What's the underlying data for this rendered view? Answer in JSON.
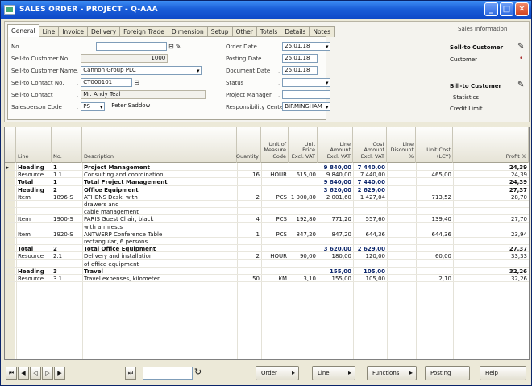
{
  "window": {
    "title": "SALES ORDER - PROJECT - Q-AAA"
  },
  "tabs": [
    "General",
    "Line",
    "Invoice",
    "Delivery",
    "Foreign Trade",
    "Dimension",
    "Setup",
    "Other",
    "Totals",
    "Details",
    "Notes"
  ],
  "form_left": [
    {
      "label": "No.",
      "value": "",
      "kind": "input-pick"
    },
    {
      "label": "Sell-to Customer No.",
      "value": "1000",
      "kind": "ro"
    },
    {
      "label": "Sell-to Customer Name",
      "value": "Cannon Group PLC",
      "kind": "dropdown"
    },
    {
      "label": "Sell-to Contact No.",
      "value": "CT000101",
      "kind": "input-pick"
    },
    {
      "label": "Sell-to Contact",
      "value": "Mr. Andy Teal",
      "kind": "ro"
    },
    {
      "label": "Salesperson Code",
      "value": "PS",
      "kind": "dropdown",
      "extra": "Peter Saddow"
    }
  ],
  "form_right": [
    {
      "label": "Order Date",
      "value": "25.01.18",
      "kind": "dropdown"
    },
    {
      "label": "Posting Date",
      "value": "25.01.18",
      "kind": "input"
    },
    {
      "label": "Document Date",
      "value": "25.01.18",
      "kind": "input"
    },
    {
      "label": "Status",
      "value": "",
      "kind": "dropdown"
    },
    {
      "label": "Project Manager",
      "value": "",
      "kind": "input"
    },
    {
      "label": "Responsibility Center",
      "value": "BIRMINGHAM",
      "kind": "dropdown"
    }
  ],
  "side_panel": {
    "title": "Sales Information",
    "items": [
      {
        "label": "Sell-to Customer",
        "bold": true
      },
      {
        "label": "Customer",
        "bold": false
      },
      {
        "label": "Bill-to Customer",
        "bold": true
      },
      {
        "label": "Statistics",
        "bold": false
      },
      {
        "label": "Credit Limit",
        "bold": false
      }
    ]
  },
  "grid": {
    "columns": [
      "",
      "Line",
      "No.",
      "Description",
      "Quantity",
      "Unit of Measure Code",
      "Unit Price Excl. VAT",
      "Line Amount Excl. VAT",
      "Cost Amount Excl. VAT",
      "Line Discount %",
      "Unit Cost (LCY)",
      "Profit %"
    ],
    "rows": [
      {
        "mark": "▸",
        "type": "Heading",
        "no": "1",
        "desc": "Project Management",
        "qty": "",
        "uom": "",
        "price": "",
        "amt": "9 840,00",
        "cost": "7 440,00",
        "disc": "",
        "ucost": "",
        "profit": "24,39",
        "bold": true
      },
      {
        "mark": "",
        "type": "Resource",
        "no": "1.1",
        "desc": "Consulting and coordination",
        "qty": "16",
        "uom": "HOUR",
        "price": "615,00",
        "amt": "9 840,00",
        "cost": "7 440,00",
        "disc": "",
        "ucost": "465,00",
        "profit": "24,39",
        "bold": false
      },
      {
        "mark": "",
        "type": "Total",
        "no": "1",
        "desc": "Total Project Management",
        "qty": "",
        "uom": "",
        "price": "",
        "amt": "9 840,00",
        "cost": "7 440,00",
        "disc": "",
        "ucost": "",
        "profit": "24,39",
        "bold": true
      },
      {
        "mark": "",
        "type": "Heading",
        "no": "2",
        "desc": "Office Equipment",
        "qty": "",
        "uom": "",
        "price": "",
        "amt": "3 620,00",
        "cost": "2 629,00",
        "disc": "",
        "ucost": "",
        "profit": "27,37",
        "bold": true
      },
      {
        "mark": "",
        "type": "Item",
        "no": "1896-S",
        "desc": "ATHENS Desk, with",
        "qty": "2",
        "uom": "PCS",
        "price": "1 000,80",
        "amt": "2 001,60",
        "cost": "1 427,04",
        "disc": "",
        "ucost": "713,52",
        "profit": "28,70",
        "bold": false
      },
      {
        "mark": "",
        "type": "",
        "no": "",
        "desc": "drawers and",
        "qty": "",
        "uom": "",
        "price": "",
        "amt": "",
        "cost": "",
        "disc": "",
        "ucost": "",
        "profit": "",
        "bold": false
      },
      {
        "mark": "",
        "type": "",
        "no": "",
        "desc": "cable management",
        "qty": "",
        "uom": "",
        "price": "",
        "amt": "",
        "cost": "",
        "disc": "",
        "ucost": "",
        "profit": "",
        "bold": false
      },
      {
        "mark": "",
        "type": "Item",
        "no": "1900-S",
        "desc": "PARIS Guest Chair, black",
        "qty": "4",
        "uom": "PCS",
        "price": "192,80",
        "amt": "771,20",
        "cost": "557,60",
        "disc": "",
        "ucost": "139,40",
        "profit": "27,70",
        "bold": false
      },
      {
        "mark": "",
        "type": "",
        "no": "",
        "desc": "with armrests",
        "qty": "",
        "uom": "",
        "price": "",
        "amt": "",
        "cost": "",
        "disc": "",
        "ucost": "",
        "profit": "",
        "bold": false
      },
      {
        "mark": "",
        "type": "Item",
        "no": "1920-S",
        "desc": "ANTWERP Conference Table",
        "qty": "1",
        "uom": "PCS",
        "price": "847,20",
        "amt": "847,20",
        "cost": "644,36",
        "disc": "",
        "ucost": "644,36",
        "profit": "23,94",
        "bold": false
      },
      {
        "mark": "",
        "type": "",
        "no": "",
        "desc": "rectangular, 6 persons",
        "qty": "",
        "uom": "",
        "price": "",
        "amt": "",
        "cost": "",
        "disc": "",
        "ucost": "",
        "profit": "",
        "bold": false
      },
      {
        "mark": "",
        "type": "Total",
        "no": "2",
        "desc": "Total Office Equipment",
        "qty": "",
        "uom": "",
        "price": "",
        "amt": "3 620,00",
        "cost": "2 629,00",
        "disc": "",
        "ucost": "",
        "profit": "27,37",
        "bold": true
      },
      {
        "mark": "",
        "type": "Resource",
        "no": "2.1",
        "desc": "Delivery and installation",
        "qty": "2",
        "uom": "HOUR",
        "price": "90,00",
        "amt": "180,00",
        "cost": "120,00",
        "disc": "",
        "ucost": "60,00",
        "profit": "33,33",
        "bold": false
      },
      {
        "mark": "",
        "type": "",
        "no": "",
        "desc": "of office equipment",
        "qty": "",
        "uom": "",
        "price": "",
        "amt": "",
        "cost": "",
        "disc": "",
        "ucost": "",
        "profit": "",
        "bold": false
      },
      {
        "mark": "",
        "type": "Heading",
        "no": "3",
        "desc": "Travel",
        "qty": "",
        "uom": "",
        "price": "",
        "amt": "155,00",
        "cost": "105,00",
        "disc": "",
        "ucost": "",
        "profit": "32,26",
        "bold": true
      },
      {
        "mark": "",
        "type": "Resource",
        "no": "3.1",
        "desc": "Travel expenses, kilometer",
        "qty": "50",
        "uom": "KM",
        "price": "3,10",
        "amt": "155,00",
        "cost": "105,00",
        "disc": "",
        "ucost": "2,10",
        "profit": "32,26",
        "bold": false
      }
    ]
  },
  "bottom": {
    "nav": [
      "⏮",
      "◀",
      "◁",
      "▷",
      "▶",
      "⏭"
    ],
    "record_input": "",
    "buttons": [
      {
        "label": "Order",
        "has_menu": true
      },
      {
        "label": "Line",
        "has_menu": true
      },
      {
        "label": "Functions",
        "has_menu": true
      },
      {
        "label": "Posting",
        "has_menu": false
      },
      {
        "label": "Help",
        "has_menu": false
      }
    ]
  }
}
